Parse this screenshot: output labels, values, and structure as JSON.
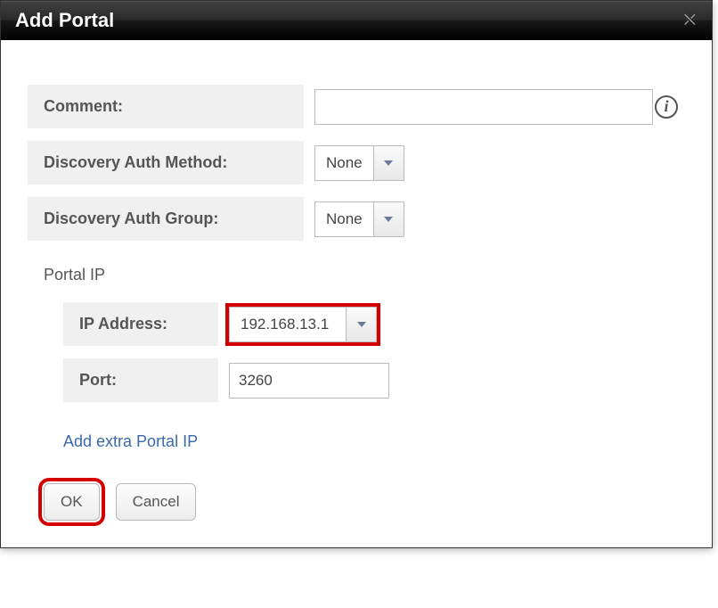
{
  "titlebar": {
    "title": "Add Portal",
    "close_glyph": "⛌"
  },
  "form": {
    "comment": {
      "label": "Comment:",
      "value": ""
    },
    "discovery_auth_method": {
      "label": "Discovery Auth Method:",
      "selected": "None"
    },
    "discovery_auth_group": {
      "label": "Discovery Auth Group:",
      "selected": "None"
    },
    "portal_ip": {
      "section_label": "Portal IP",
      "ip_address": {
        "label": "IP Address:",
        "selected": "192.168.13.1"
      },
      "port": {
        "label": "Port:",
        "value": "3260"
      },
      "add_extra_link": "Add extra Portal IP"
    }
  },
  "buttons": {
    "ok": "OK",
    "cancel": "Cancel"
  },
  "info_glyph": "i"
}
